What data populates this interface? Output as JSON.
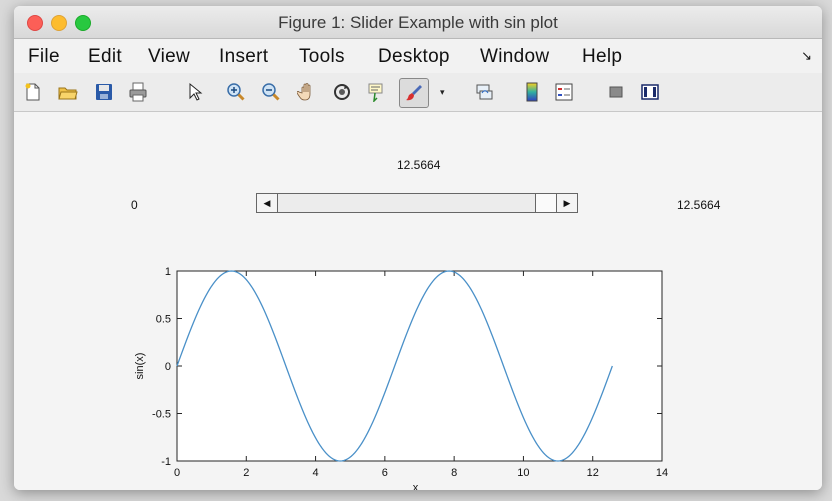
{
  "window": {
    "title": "Figure 1: Slider Example with sin plot"
  },
  "menubar": {
    "items": [
      "File",
      "Edit",
      "View",
      "Insert",
      "Tools",
      "Desktop",
      "Window",
      "Help"
    ]
  },
  "toolbar": {
    "icons": [
      "new-figure-icon",
      "open-file-icon",
      "save-icon",
      "print-icon",
      "pointer-icon",
      "zoom-in-icon",
      "zoom-out-icon",
      "pan-hand-icon",
      "rotate-3d-icon",
      "data-cursor-icon",
      "brush-icon",
      "brush-dropdown-icon",
      "link-plot-icon",
      "colorbar-icon",
      "legend-icon",
      "hide-plot-tools-icon",
      "show-plot-tools-icon"
    ]
  },
  "slider": {
    "value_label": "12.5664",
    "min_label": "0",
    "max_label": "12.5664",
    "min": 0,
    "max": 12.5664,
    "value": 12.5664
  },
  "chart_data": {
    "type": "line",
    "title": "",
    "xlabel": "x",
    "ylabel": "sin(x)",
    "xlim": [
      0,
      14
    ],
    "ylim": [
      -1,
      1
    ],
    "xticks": [
      0,
      2,
      4,
      6,
      8,
      10,
      12,
      14
    ],
    "yticks": [
      -1,
      -0.5,
      0,
      0.5,
      1
    ],
    "grid": false,
    "series": [
      {
        "function": "sin(x)",
        "x_range": [
          0,
          12.5664
        ],
        "color": "#4a90c8"
      }
    ]
  }
}
